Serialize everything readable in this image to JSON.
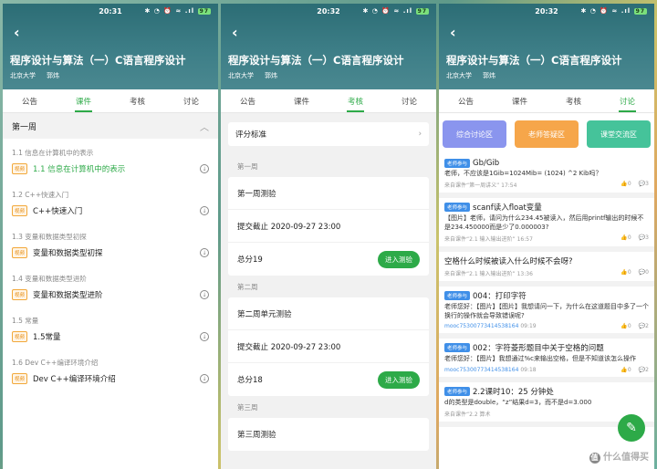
{
  "status": {
    "time1": "20:31",
    "time2": "20:32",
    "time3": "20:32",
    "icons": "✱ ◔ ⏰ ≈ .ıl",
    "battery": "97"
  },
  "course": {
    "title": "程序设计与算法（一）C语言程序设计",
    "school": "北京大学",
    "teacher": "郭炜"
  },
  "tabs": [
    "公告",
    "课件",
    "考核",
    "讨论"
  ],
  "panel1": {
    "week": "第一周",
    "sections": [
      {
        "title": "1.1 信息在计算机中的表示",
        "badge": "视频",
        "lesson": "1.1 信息在计算机中的表示",
        "active": true
      },
      {
        "title": "1.2 C++快速入门",
        "badge": "视频",
        "lesson": "C++快速入门"
      },
      {
        "title": "1.3 变量和数据类型初探",
        "badge": "视频",
        "lesson": "变量和数据类型初探"
      },
      {
        "title": "1.4 变量和数据类型进阶",
        "badge": "视频",
        "lesson": "变量和数据类型进阶"
      },
      {
        "title": "1.5 常量",
        "badge": "视频",
        "lesson": "1.5常量"
      },
      {
        "title": "1.6 Dev C++编译环境介绍",
        "badge": "视频",
        "lesson": "Dev C++编译环境介绍"
      }
    ]
  },
  "panel2": {
    "criteria": "评分标准",
    "weeks": [
      {
        "label": "第一周",
        "quiz": "第一周测验",
        "deadline": "提交截止 2020-09-27 23:00",
        "score": "总分19",
        "enter": "进入测验"
      },
      {
        "label": "第二周",
        "quiz": "第二周单元测验",
        "deadline": "提交截止 2020-09-27 23:00",
        "score": "总分18",
        "enter": "进入测验"
      },
      {
        "label": "第三周",
        "quiz": "第三周测验"
      }
    ]
  },
  "panel3": {
    "categories": [
      {
        "label": "综合讨论区",
        "color": "#8a95ee"
      },
      {
        "label": "老师答疑区",
        "color": "#f6a64a"
      },
      {
        "label": "课堂交流区",
        "color": "#45c39a"
      }
    ],
    "posts": [
      {
        "tag": "老师参与",
        "title": "Gb/Gib",
        "body": "老师，不应该是1Gib=1024Mib= (1024) ^2 Kib吗？",
        "src": "来自课件“第一周讲义”",
        "time": "17:54",
        "likes": "0",
        "replies": "3"
      },
      {
        "tag": "老师参与",
        "title": "scanf读入float变量",
        "body": "【图片】老师，请问为什么234.45被读入，然后用printf输出的时候不是234.450000而是少了0.000003?",
        "src": "来自课件“2.1 输入输出进阶”",
        "time": "16:57",
        "likes": "0",
        "replies": "3"
      },
      {
        "tag": "",
        "title": "空格什么时候被读入什么时候不会呀?",
        "body": "",
        "src": "来自课件“2.1 输入输出进阶”",
        "time": "13:36",
        "likes": "0",
        "replies": "0"
      },
      {
        "tag": "老师参与",
        "title": "004：打印字符",
        "body": "老师您好：【图片】【图片】我想请问一下，为什么在这道题目中多了一个换行的操作就会导致错误呢?",
        "src": "mooc75300773414538164",
        "time": "09:19",
        "likes": "0",
        "replies": "2"
      },
      {
        "tag": "老师参与",
        "title": "002：字符菱形题目中关于空格的问题",
        "body": "老师您好：【图片】我想通过%c来输出空格，但是不知道该怎么操作",
        "src": "mooc75300773414538164",
        "time": "09:18",
        "likes": "0",
        "replies": "2"
      },
      {
        "tag": "老师参与",
        "title": "2.2课时10：25 分钟处",
        "body": "d的类型是double，“z”结果d=3，而不是d=3.000",
        "src": "来自课件“2.2 算术",
        "time": "",
        "likes": "",
        "replies": ""
      }
    ],
    "fab": "✎"
  },
  "watermark": {
    "circle": "值",
    "text": "什么值得买"
  }
}
